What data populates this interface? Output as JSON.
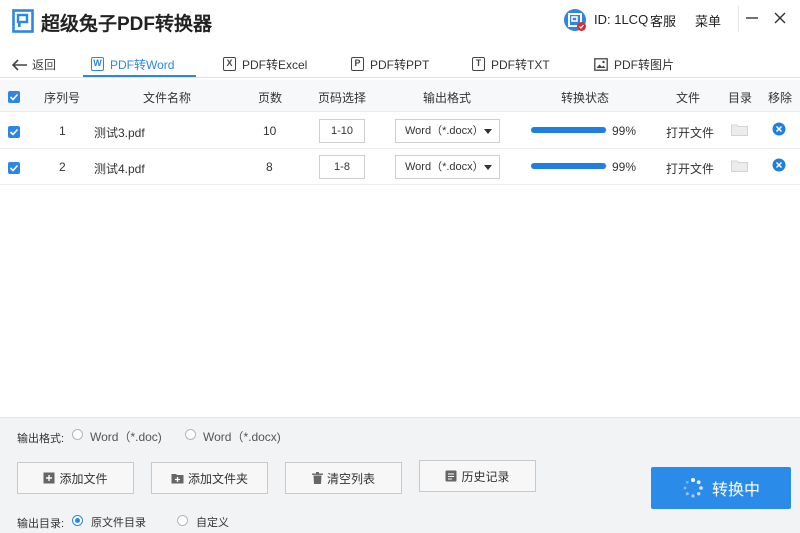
{
  "app": {
    "title": "超级兔子PDF转换器",
    "user_id": "ID: 1LCQ",
    "service": "客服",
    "menu": "菜单"
  },
  "nav": {
    "back_label": "返回",
    "tabs": [
      {
        "label": "PDF转Word",
        "icon": "W",
        "active": true
      },
      {
        "label": "PDF转Excel",
        "icon": "X",
        "active": false
      },
      {
        "label": "PDF转PPT",
        "icon": "P",
        "active": false
      },
      {
        "label": "PDF转TXT",
        "icon": "T",
        "active": false
      },
      {
        "label": "PDF转图片",
        "icon": "image",
        "active": false
      }
    ]
  },
  "table": {
    "headers": {
      "index": "序列号",
      "filename": "文件名称",
      "pages": "页数",
      "page_select": "页码选择",
      "output_format": "输出格式",
      "status": "转换状态",
      "file": "文件",
      "directory": "目录",
      "remove": "移除"
    },
    "rows": [
      {
        "index": "1",
        "filename": "测试3.pdf",
        "pages": "10",
        "page_range": "1-10",
        "format": "Word（*.docx）",
        "progress": 0.99,
        "percent": "99%",
        "open_label": "打开文件",
        "checked": true
      },
      {
        "index": "2",
        "filename": "测试4.pdf",
        "pages": "8",
        "page_range": "1-8",
        "format": "Word（*.docx）",
        "progress": 0.99,
        "percent": "99%",
        "open_label": "打开文件",
        "checked": true
      }
    ]
  },
  "options": {
    "format_label": "输出格式:",
    "format_choices": [
      "Word（*.doc)",
      "Word（*.docx)"
    ],
    "dir_label": "输出目录:",
    "dir_choices": [
      "原文件目录",
      "自定义"
    ],
    "dir_selected": 0
  },
  "actions": {
    "add_file": "添加文件",
    "add_folder": "添加文件夹",
    "clear_list": "清空列表",
    "history": "历史记录",
    "convert": "转换中"
  },
  "colors": {
    "accent": "#2d86e3",
    "convert_button": "#2b8be9",
    "remove_icon": "#1e7fe0"
  }
}
